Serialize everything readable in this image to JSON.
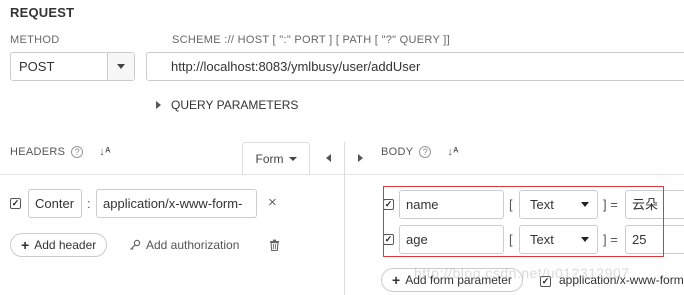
{
  "request": {
    "title": "REQUEST",
    "method_label": "METHOD",
    "method_value": "POST",
    "url_label": "SCHEME :// HOST [ \":\" PORT ] [ PATH [ \"?\" QUERY ]]",
    "url_value": "http://localhost:8083/ymlbusy/user/addUser",
    "query_params_label": "QUERY PARAMETERS"
  },
  "headers": {
    "label": "HEADERS",
    "help_glyph": "?",
    "sort_glyph": "↓ᴬ",
    "form_tab_label": "Form",
    "rows": [
      {
        "checked": "✓",
        "key": "Conter",
        "separator": ":",
        "value": "application/x-www-form-",
        "remove": "×"
      }
    ],
    "add_header_label": "Add header",
    "add_authorization_label": "Add authorization",
    "icons": {
      "key": "key-icon",
      "trash": "trash-icon"
    }
  },
  "body": {
    "label": "BODY",
    "help_glyph": "?",
    "sort_glyph": "↓ᴬ",
    "rows": [
      {
        "checked": "✓",
        "name": "name",
        "open_bracket": "[",
        "type": "Text",
        "close_eq": "] =",
        "value": "云朵"
      },
      {
        "checked": "✓",
        "name": "age",
        "open_bracket": "[",
        "type": "Text",
        "close_eq": "] =",
        "value": "25"
      }
    ],
    "add_form_parameter_label": "Add form parameter",
    "content_type_checked": "✓",
    "content_type_label": "application/x-www-form"
  },
  "watermark": "http://blog.csdn.net/u012312907",
  "colors": {
    "highlight_border": "#d93a3a",
    "border": "#cccccc",
    "text": "#333333"
  }
}
